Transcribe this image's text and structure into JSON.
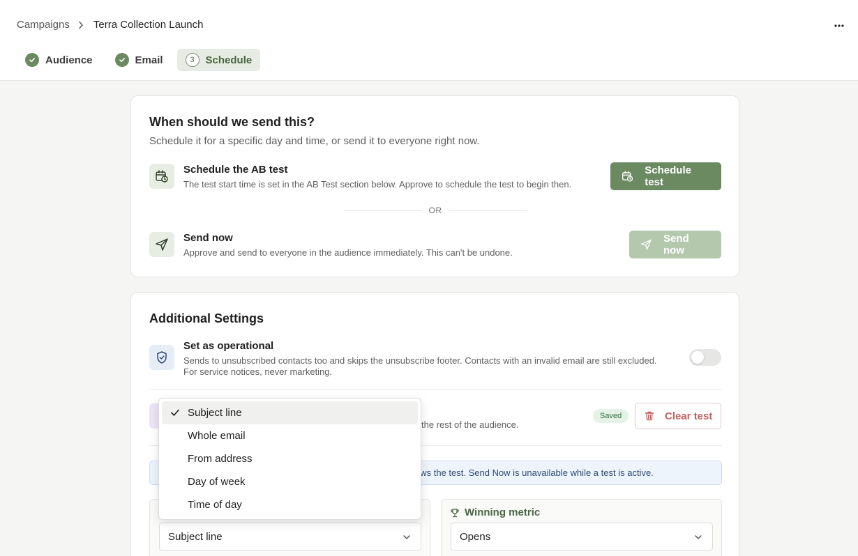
{
  "breadcrumb": {
    "parent": "Campaigns",
    "current": "Terra Collection Launch"
  },
  "steps": [
    {
      "label": "Audience",
      "state": "done"
    },
    {
      "label": "Email",
      "state": "done"
    },
    {
      "label": "Schedule",
      "state": "active",
      "number": "3"
    }
  ],
  "send_card": {
    "title": "When should we send this?",
    "subtitle": "Schedule it for a specific day and time, or send it to everyone right now.",
    "schedule": {
      "title": "Schedule the AB test",
      "description": "The test start time is set in the AB Test section below. Approve to schedule the test to begin then.",
      "button": "Schedule test"
    },
    "divider": "OR",
    "send_now": {
      "title": "Send now",
      "description": "Approve and send to everyone in the audience immediately. This can't be undone.",
      "button": "Send now"
    }
  },
  "settings_card": {
    "title": "Additional Settings",
    "operational": {
      "title": "Set as operational",
      "description_line1": "Sends to unsubscribed contacts too and skips the unsubscribe footer. Contacts with an invalid email are still excluded.",
      "description_line2": "For service notices, never marketing.",
      "enabled": false
    },
    "ab_test": {
      "description_fragment": "the rest of the audience.",
      "badge": "Saved",
      "clear_button": "Clear test"
    },
    "info_fragment": "ows the test. Send Now is unavailable while a test is active.",
    "test_variable": {
      "value": "Subject line"
    },
    "winning_metric": {
      "label": "Winning metric",
      "value": "Opens"
    }
  },
  "dropdown": {
    "options": [
      "Subject line",
      "Whole email",
      "From address",
      "Day of week",
      "Time of day"
    ],
    "selected": "Subject line"
  },
  "colors": {
    "primary_green": "#6b8a62",
    "disabled_green": "#b3c8ad",
    "danger": "#c95d5d",
    "info_bg": "#eef4fc"
  }
}
